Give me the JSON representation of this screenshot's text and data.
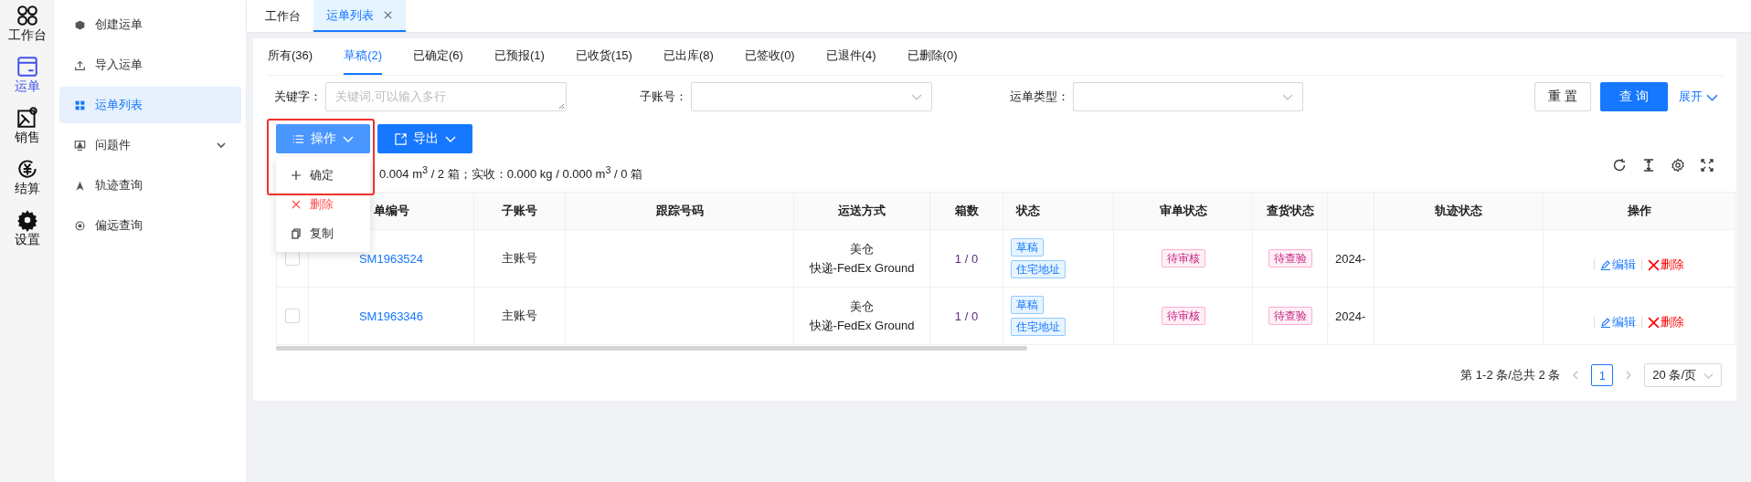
{
  "rail": [
    {
      "label": "工作台",
      "selected": false
    },
    {
      "label": "运单",
      "selected": true
    },
    {
      "label": "销售",
      "selected": false
    },
    {
      "label": "结算",
      "selected": false
    },
    {
      "label": "设置",
      "selected": false
    }
  ],
  "menu": [
    {
      "label": "创建运单",
      "selected": false,
      "kind": "link"
    },
    {
      "label": "导入运单",
      "selected": false,
      "kind": "link"
    },
    {
      "label": "运单列表",
      "selected": true,
      "kind": "link"
    },
    {
      "label": "问题件",
      "selected": false,
      "kind": "group"
    },
    {
      "label": "轨迹查询",
      "selected": false,
      "kind": "link"
    },
    {
      "label": "偏远查询",
      "selected": false,
      "kind": "link"
    }
  ],
  "page_tabs": [
    {
      "label": "工作台",
      "selected": false,
      "closable": false
    },
    {
      "label": "运单列表",
      "selected": true,
      "closable": true
    }
  ],
  "status_tabs": [
    {
      "label": "所有(36)",
      "selected": false
    },
    {
      "label": "草稿(2)",
      "selected": true
    },
    {
      "label": "已确定(6)",
      "selected": false
    },
    {
      "label": "已预报(1)",
      "selected": false
    },
    {
      "label": "已收货(15)",
      "selected": false
    },
    {
      "label": "已出库(8)",
      "selected": false
    },
    {
      "label": "已签收(0)",
      "selected": false
    },
    {
      "label": "已退件(4)",
      "selected": false
    },
    {
      "label": "已删除(0)",
      "selected": false
    }
  ],
  "filters": [
    {
      "label": "关键字：",
      "kind": "textarea",
      "placeholder": "关键词,可以输入多行"
    },
    {
      "label": "子账号：",
      "kind": "select"
    },
    {
      "label": "运单类型：",
      "kind": "select"
    }
  ],
  "filter_buttons": {
    "reset": "重 置",
    "query": "查 询",
    "expand": "展开"
  },
  "actions": [
    {
      "label": "操作",
      "kind": "operate",
      "open": true
    },
    {
      "label": "导出",
      "kind": "export",
      "open": false
    }
  ],
  "dropdown": [
    {
      "label": "确定",
      "kind": "add"
    },
    {
      "label": "删除",
      "kind": "danger"
    },
    {
      "label": "复制",
      "kind": "copy"
    }
  ],
  "summary": "0.004 m$^{3}$ / 2 箱；实收：0.000 kg / 0.000 m$^{3}$ / 0 箱",
  "table": {
    "columns": [
      "单编号",
      "子账号",
      "跟踪号码",
      "运送方式",
      "箱数",
      "状态",
      "审单状态",
      "查货状态",
      "",
      "轨迹状态",
      "操作"
    ],
    "rows": [
      {
        "checked": false,
        "order": "SM1963524",
        "account": "主账号",
        "tracking": "",
        "shipping": [
          "美仓",
          "快递-FedEx Ground"
        ],
        "boxes": "1 / 0",
        "tags": [
          "草稿",
          "住宅地址"
        ],
        "audit": "待审核",
        "inspect": "待查验",
        "column_10": "2024-",
        "track": "",
        "ops": [
          "编辑",
          "删除"
        ]
      },
      {
        "checked": false,
        "order": "SM1963346",
        "account": "主账号",
        "tracking": "",
        "shipping": [
          "美仓",
          "快递-FedEx Ground"
        ],
        "boxes": "1 / 0",
        "tags": [
          "草稿",
          "住宅地址"
        ],
        "audit": "待审核",
        "inspect": "待查验",
        "column_10": "2024-",
        "track": "",
        "ops": [
          "编辑",
          "删除"
        ]
      }
    ]
  },
  "pagination": {
    "summary": "第 1-2 条/总共 2 条",
    "pages": [
      {
        "label": "1",
        "selected": true
      }
    ],
    "page_size": "20 条/页"
  }
}
